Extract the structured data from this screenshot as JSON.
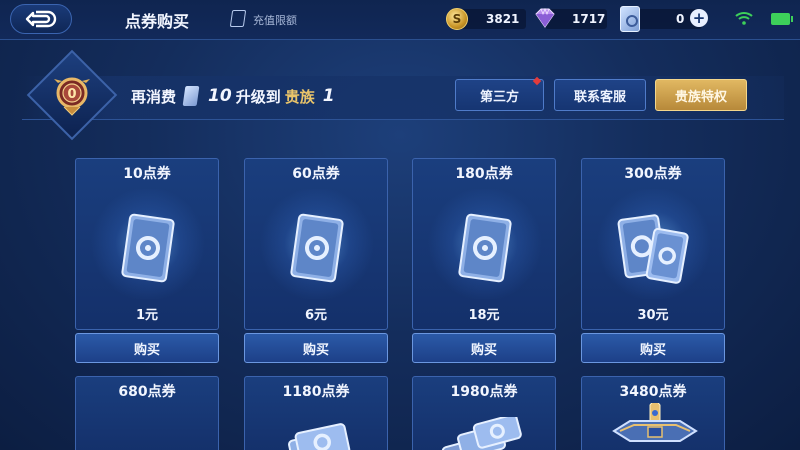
{
  "header": {
    "title": "点券购买",
    "limit_label": "充值限额",
    "coins": "3821",
    "diamonds": "1717",
    "vouchers": "0",
    "plus": "+"
  },
  "vip": {
    "prefix": "再消费",
    "amount": "10",
    "upgrade_to": "升级到",
    "noble_label": "贵族",
    "noble_level": "1",
    "badge_level": "0"
  },
  "buttons": {
    "third_party": "第三方",
    "support": "联系客服",
    "privileges": "贵族特权"
  },
  "packages": [
    {
      "title": "10点券",
      "price": "1元",
      "buy": "购买"
    },
    {
      "title": "60点券",
      "price": "6元",
      "buy": "购买"
    },
    {
      "title": "180点券",
      "price": "18元",
      "buy": "购买"
    },
    {
      "title": "300点券",
      "price": "30元",
      "buy": "购买"
    },
    {
      "title": "680点券"
    },
    {
      "title": "1180点券"
    },
    {
      "title": "1980点券"
    },
    {
      "title": "3480点券"
    }
  ],
  "colors": {
    "background": "#142d5c",
    "accent_gold": "#d9ad55",
    "button_blue": "#1d4088",
    "status_green": "#3dd05a"
  }
}
